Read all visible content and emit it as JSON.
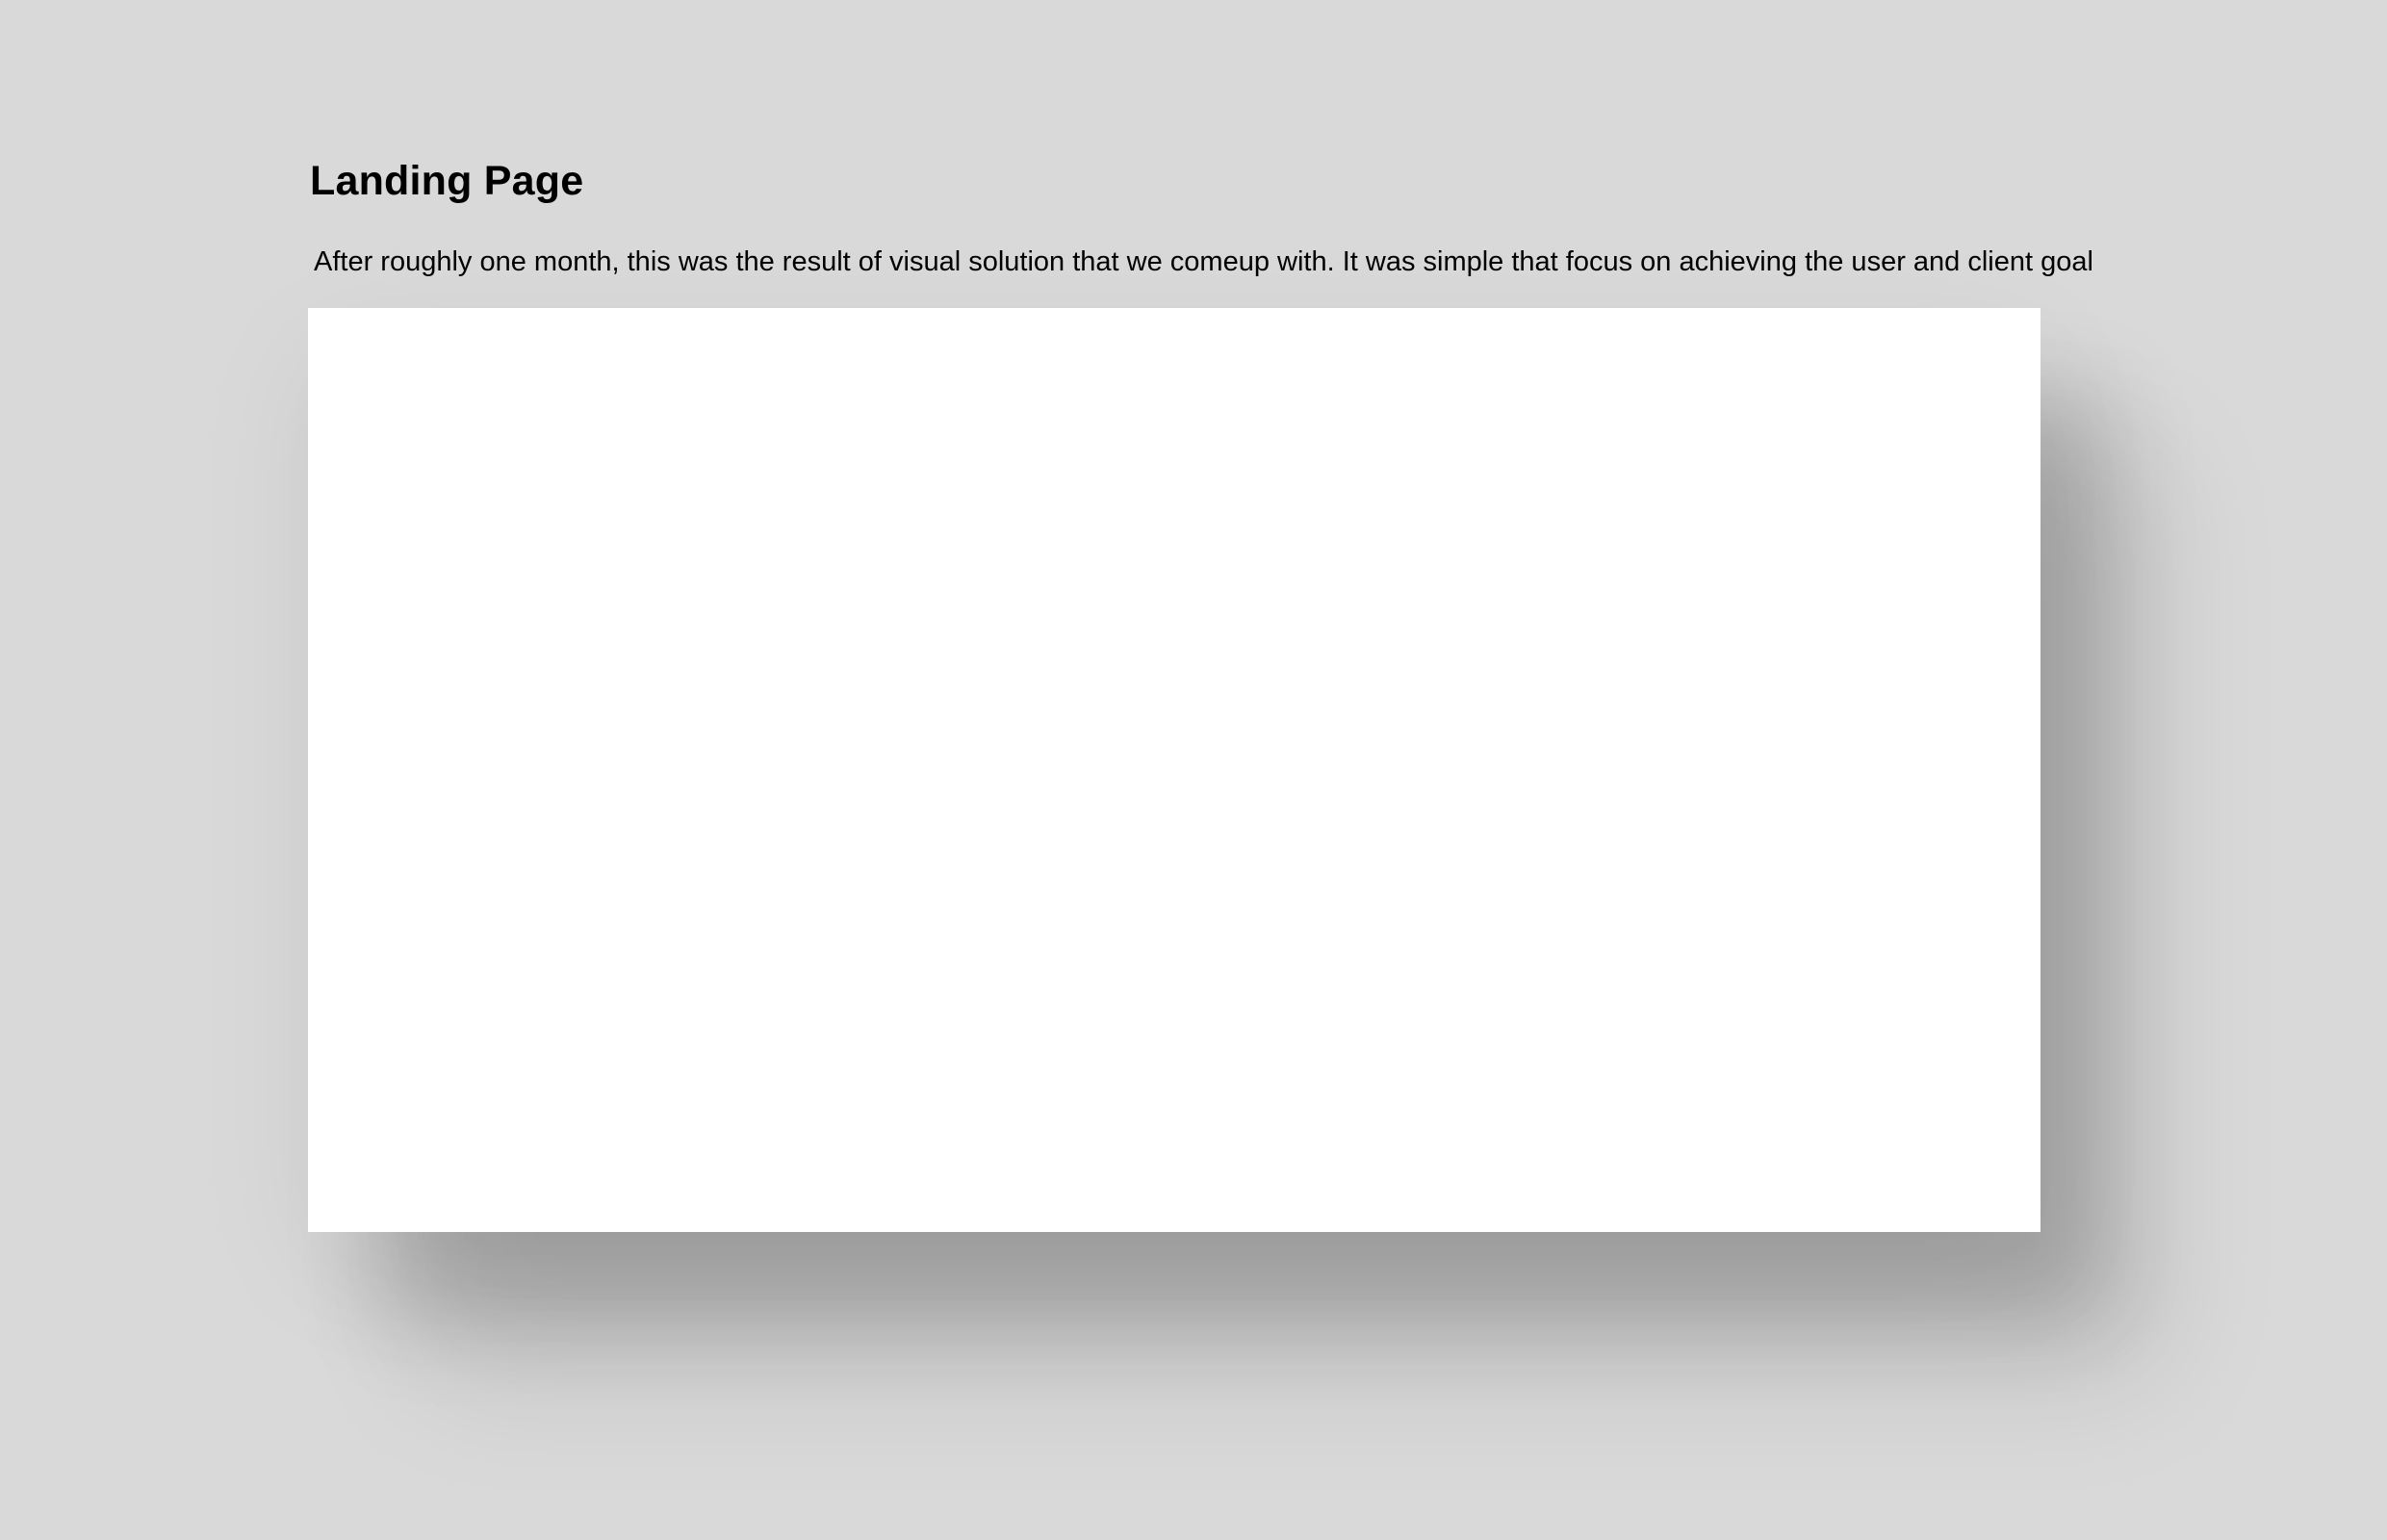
{
  "section": {
    "title": "Landing Page",
    "description": "After roughly one month, this was the result of visual solution that we comeup with. It was simple that focus on achieving the user and client goal"
  },
  "colors": {
    "background": "#d9d9d9",
    "frame": "#ffffff",
    "text": "#000000"
  }
}
